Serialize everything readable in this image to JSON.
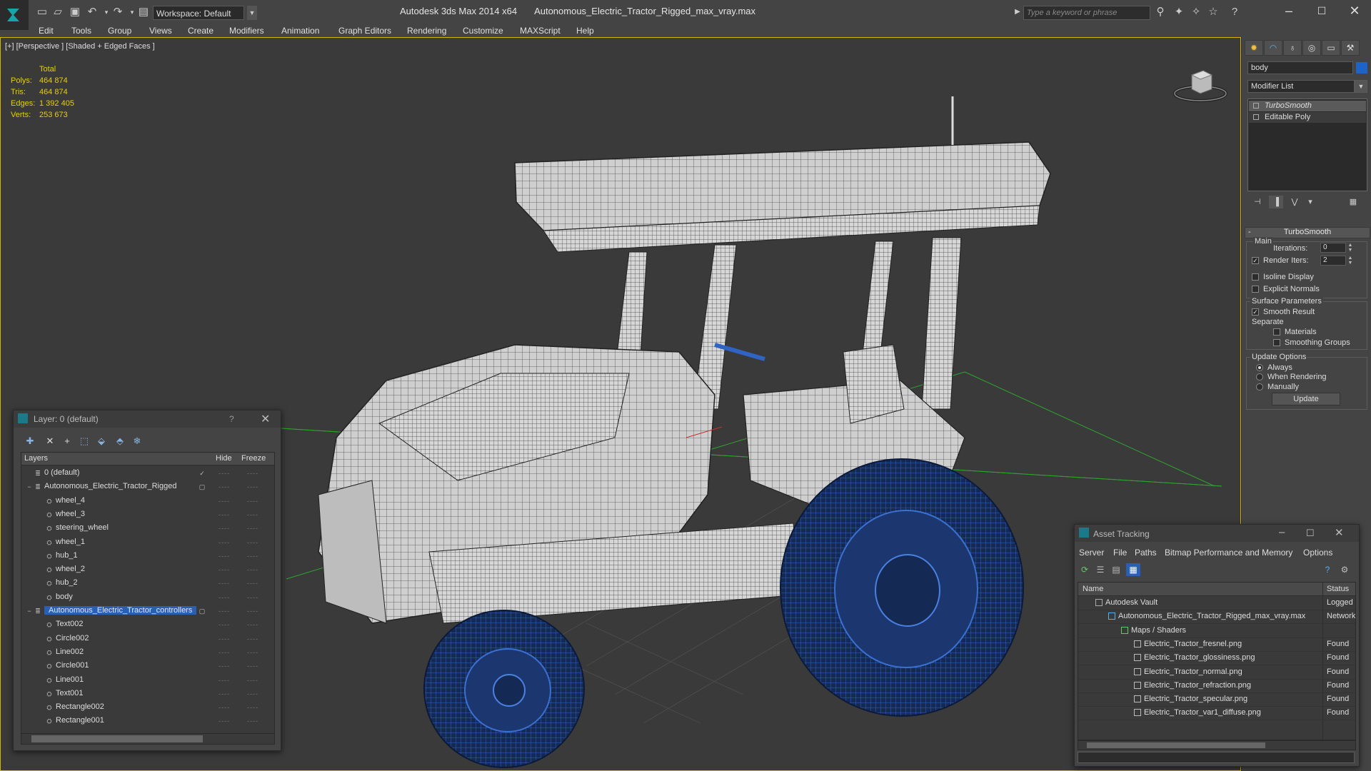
{
  "app": {
    "title": "Autodesk 3ds Max  2014 x64",
    "file": "Autonomous_Electric_Tractor_Rigged_max_vray.max",
    "workspace": "Workspace: Default",
    "search_placeholder": "Type a keyword or phrase"
  },
  "menu": [
    "Edit",
    "Tools",
    "Group",
    "Views",
    "Create",
    "Modifiers",
    "Animation",
    "Graph Editors",
    "Rendering",
    "Customize",
    "MAXScript",
    "Help"
  ],
  "viewport": {
    "label": "[+] [Perspective ] [Shaded + Edged Faces ]",
    "stats_header": "Total",
    "stats": [
      {
        "key": "Polys:",
        "value": "464 874"
      },
      {
        "key": "Tris:",
        "value": "464 874"
      },
      {
        "key": "Edges:",
        "value": "1 392 405"
      },
      {
        "key": "Verts:",
        "value": "253 673"
      }
    ]
  },
  "command_panel": {
    "object_name": "body",
    "object_color": "#1e64c8",
    "modifier_list": "Modifier List",
    "stack": [
      "TurboSmooth",
      "Editable Poly"
    ],
    "rollout_title": "TurboSmooth",
    "main_label": "Main",
    "iterations_label": "Iterations:",
    "iterations_value": "0",
    "render_iters_label": "Render Iters:",
    "render_iters_value": "2",
    "isoline_label": "Isoline Display",
    "explicit_normals_label": "Explicit Normals",
    "surface_params_label": "Surface Parameters",
    "smooth_result_label": "Smooth Result",
    "separate_label": "Separate",
    "materials_label": "Materials",
    "smoothing_groups_label": "Smoothing Groups",
    "update_options_label": "Update Options",
    "always_label": "Always",
    "when_rendering_label": "When Rendering",
    "manually_label": "Manually",
    "update_button": "Update"
  },
  "layer_dialog": {
    "title": "Layer: 0 (default)",
    "help": "?",
    "col_layers": "Layers",
    "col_hide": "Hide",
    "col_freeze": "Freeze",
    "rows": [
      {
        "name": "0 (default)",
        "level": 0,
        "check": true
      },
      {
        "name": "Autonomous_Electric_Tractor_Rigged",
        "level": 0,
        "box": true
      },
      {
        "name": "wheel_4",
        "level": 1
      },
      {
        "name": "wheel_3",
        "level": 1
      },
      {
        "name": "steering_wheel",
        "level": 1
      },
      {
        "name": "wheel_1",
        "level": 1
      },
      {
        "name": "hub_1",
        "level": 1
      },
      {
        "name": "wheel_2",
        "level": 1
      },
      {
        "name": "hub_2",
        "level": 1
      },
      {
        "name": "body",
        "level": 1
      },
      {
        "name": "Autonomous_Electric_Tractor_controllers",
        "level": 0,
        "selected": true,
        "box": true
      },
      {
        "name": "Text002",
        "level": 1
      },
      {
        "name": "Circle002",
        "level": 1
      },
      {
        "name": "Line002",
        "level": 1
      },
      {
        "name": "Circle001",
        "level": 1
      },
      {
        "name": "Line001",
        "level": 1
      },
      {
        "name": "Text001",
        "level": 1
      },
      {
        "name": "Rectangle002",
        "level": 1
      },
      {
        "name": "Rectangle001",
        "level": 1
      }
    ]
  },
  "asset_dialog": {
    "title": "Asset Tracking",
    "menu": [
      "Server",
      "File",
      "Paths",
      "Bitmap Performance and Memory",
      "Options"
    ],
    "col_name": "Name",
    "col_status": "Status",
    "rows": [
      {
        "name": "Autodesk Vault",
        "status": "Logged (",
        "level": 1
      },
      {
        "name": "Autonomous_Electric_Tractor_Rigged_max_vray.max",
        "status": "Network",
        "level": 2
      },
      {
        "name": "Maps / Shaders",
        "status": "",
        "level": 3
      },
      {
        "name": "Electric_Tractor_fresnel.png",
        "status": "Found",
        "level": 4
      },
      {
        "name": "Electric_Tractor_glossiness.png",
        "status": "Found",
        "level": 4
      },
      {
        "name": "Electric_Tractor_normal.png",
        "status": "Found",
        "level": 4
      },
      {
        "name": "Electric_Tractor_refraction.png",
        "status": "Found",
        "level": 4
      },
      {
        "name": "Electric_Tractor_specular.png",
        "status": "Found",
        "level": 4
      },
      {
        "name": "Electric_Tractor_var1_diffuse.png",
        "status": "Found",
        "level": 4
      }
    ]
  }
}
